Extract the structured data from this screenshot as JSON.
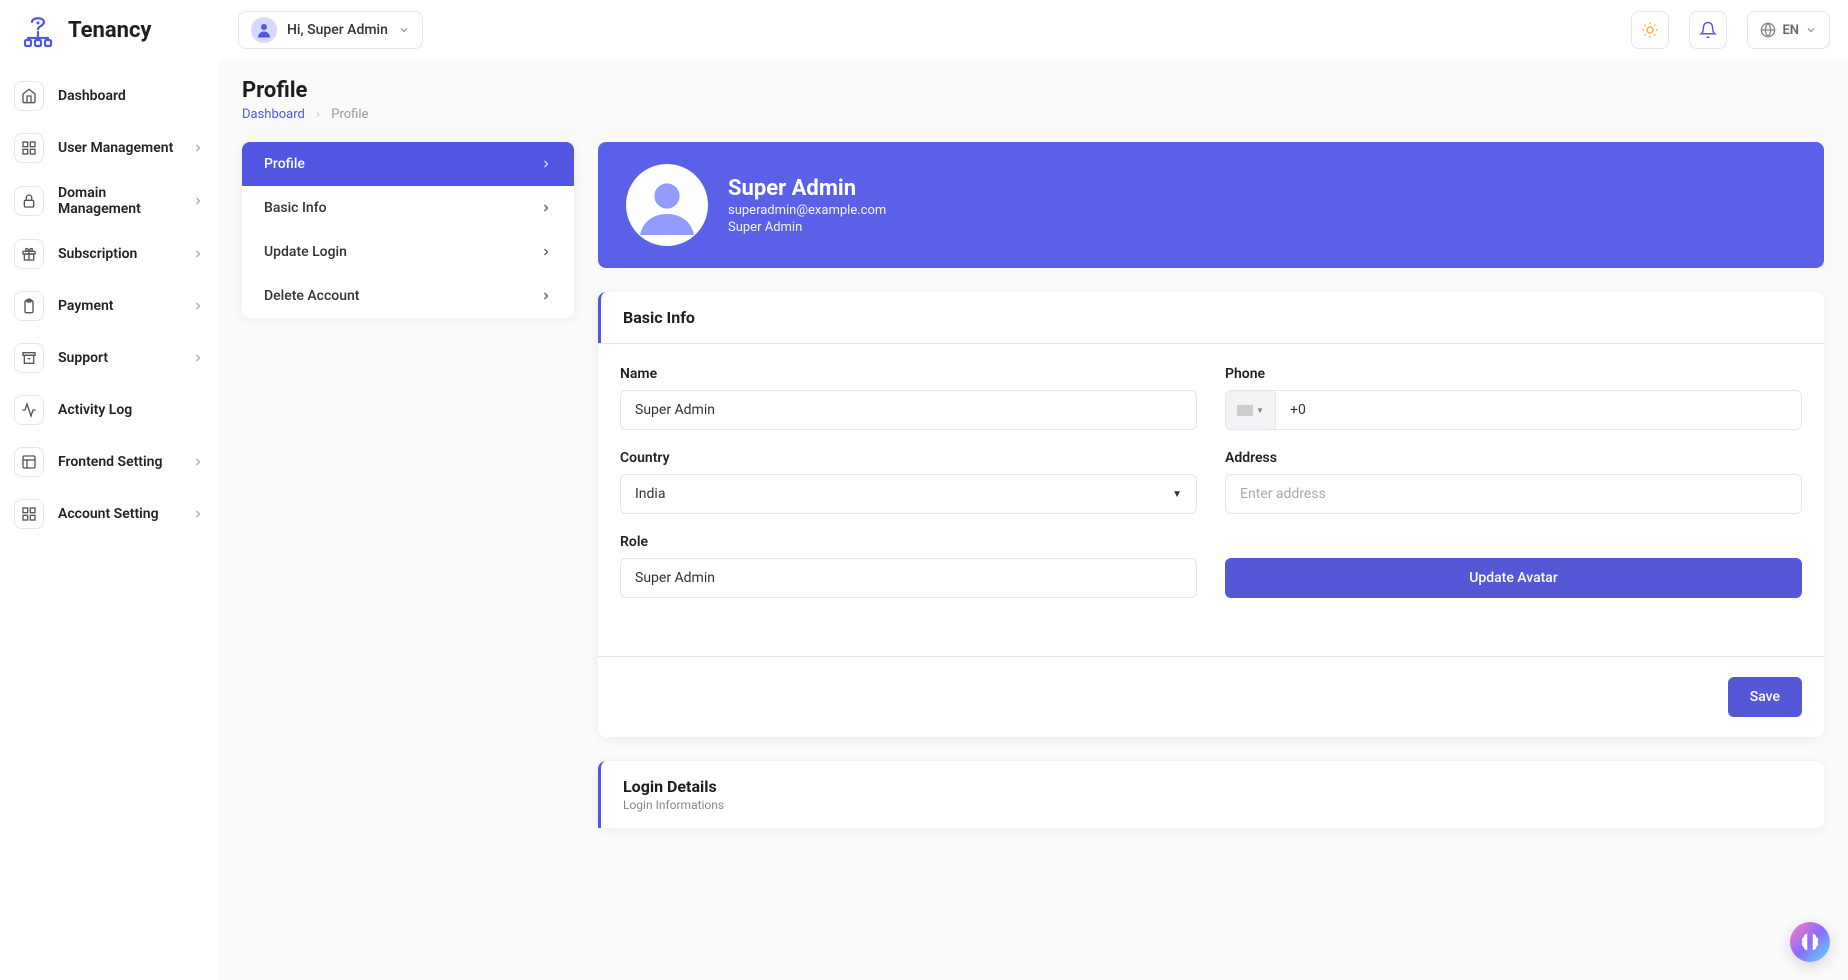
{
  "brand": {
    "name": "Tenancy"
  },
  "header": {
    "greeting": "Hi, Super Admin",
    "language": "EN"
  },
  "sidebar": {
    "items": [
      {
        "label": "Dashboard",
        "icon": "home",
        "expandable": false
      },
      {
        "label": "User Management",
        "icon": "grid",
        "expandable": true
      },
      {
        "label": "Domain Management",
        "icon": "lock",
        "expandable": true
      },
      {
        "label": "Subscription",
        "icon": "gift",
        "expandable": true
      },
      {
        "label": "Payment",
        "icon": "clipboard",
        "expandable": true
      },
      {
        "label": "Support",
        "icon": "archive",
        "expandable": true
      },
      {
        "label": "Activity Log",
        "icon": "activity",
        "expandable": false
      },
      {
        "label": "Frontend Setting",
        "icon": "layout",
        "expandable": true
      },
      {
        "label": "Account Setting",
        "icon": "grid",
        "expandable": true
      }
    ]
  },
  "page": {
    "title": "Profile",
    "crumbs": {
      "root": "Dashboard",
      "current": "Profile"
    }
  },
  "subnav": {
    "items": [
      {
        "label": "Profile",
        "active": true
      },
      {
        "label": "Basic Info",
        "active": false
      },
      {
        "label": "Update Login",
        "active": false
      },
      {
        "label": "Delete Account",
        "active": false
      }
    ]
  },
  "profile": {
    "name": "Super Admin",
    "email": "superadmin@example.com",
    "role": "Super Admin"
  },
  "basic_info": {
    "heading": "Basic Info",
    "name_label": "Name",
    "name_value": "Super Admin",
    "phone_label": "Phone",
    "phone_value": "+0",
    "country_label": "Country",
    "country_value": "India",
    "address_label": "Address",
    "address_placeholder": "Enter address",
    "role_label": "Role",
    "role_value": "Super Admin",
    "update_avatar_btn": "Update Avatar",
    "save_btn": "Save"
  },
  "login_details": {
    "heading": "Login Details",
    "sub": "Login Informations"
  }
}
